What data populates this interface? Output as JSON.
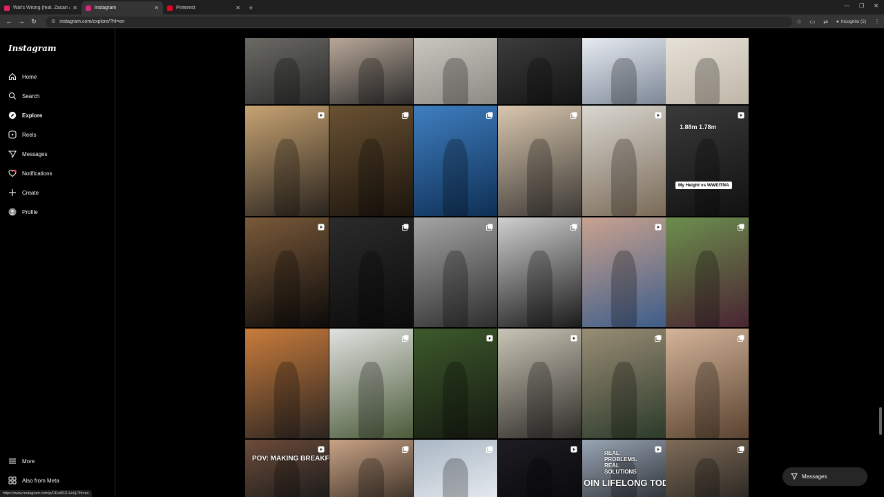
{
  "browser": {
    "tabs": [
      {
        "title": "Wat's Wrong (feat. Zacari & Ke",
        "color": "#e0245e",
        "icon": "youtube-icon"
      },
      {
        "title": "Instagram",
        "color": "#d62976",
        "icon": "instagram-icon"
      },
      {
        "title": "Pinterest",
        "color": "#e60023",
        "icon": "pinterest-icon"
      }
    ],
    "url": "instagram.com/explore/?hl=en",
    "incognito_label": "Incognito (2)",
    "status_url": "https://www.instagram.com/p/DRu8SD-Eu0j/?hl=en"
  },
  "sidebar": {
    "logo": "Instagram",
    "items": [
      {
        "label": "Home",
        "icon": "home-icon"
      },
      {
        "label": "Search",
        "icon": "search-icon"
      },
      {
        "label": "Explore",
        "icon": "compass-icon"
      },
      {
        "label": "Reels",
        "icon": "reels-icon"
      },
      {
        "label": "Messages",
        "icon": "send-icon"
      },
      {
        "label": "Notifications",
        "icon": "heart-icon"
      },
      {
        "label": "Create",
        "icon": "plus-icon"
      },
      {
        "label": "Profile",
        "icon": "avatar-icon"
      }
    ],
    "bottom_items": [
      {
        "label": "More",
        "icon": "menu-icon"
      },
      {
        "label": "Also from Meta",
        "icon": "meta-icon"
      }
    ]
  },
  "grid": {
    "tiles": [
      {
        "bg": "#6b6a65",
        "bg2": "#2a2a2a",
        "badge": "",
        "caption": ""
      },
      {
        "bg": "#b9a899",
        "bg2": "#2b2b2b",
        "badge": "",
        "caption": ""
      },
      {
        "bg": "#c9c6c0",
        "bg2": "#8d8a84",
        "badge": "",
        "caption": ""
      },
      {
        "bg": "#3c3c3c",
        "bg2": "#141414",
        "badge": "",
        "caption": ""
      },
      {
        "bg": "#e8ecf2",
        "bg2": "#7c8796",
        "badge": "",
        "caption": ""
      },
      {
        "bg": "#e6e1d8",
        "bg2": "#bfb6a7",
        "badge": "",
        "caption": ""
      },
      {
        "bg": "#c7a372",
        "bg2": "#2a241e",
        "badge": "reel",
        "caption": ""
      },
      {
        "bg": "#6a5233",
        "bg2": "#1b140d",
        "badge": "carousel",
        "caption": ""
      },
      {
        "bg": "#3f7fc0",
        "bg2": "#0e2f55",
        "badge": "carousel",
        "caption": ""
      },
      {
        "bg": "#d9c6ae",
        "bg2": "#3d3a36",
        "badge": "carousel",
        "caption": ""
      },
      {
        "bg": "#d9d7d1",
        "bg2": "#7a6a57",
        "badge": "reel",
        "caption": ""
      },
      {
        "bg": "#3a3a3a",
        "bg2": "#111",
        "badge": "reel",
        "caption": "1.88m  1.78m",
        "pill": "My Height vs WWE/TNA"
      },
      {
        "bg": "#7a5a3a",
        "bg2": "#0c0a09",
        "badge": "reel",
        "caption": ""
      },
      {
        "bg": "#2b2b2b",
        "bg2": "#0b0b0b",
        "badge": "carousel",
        "caption": ""
      },
      {
        "bg": "#a5a5a5",
        "bg2": "#2e2e2e",
        "badge": "carousel",
        "caption": ""
      },
      {
        "bg": "#cfcfcf",
        "bg2": "#1b1b1b",
        "badge": "carousel",
        "caption": ""
      },
      {
        "bg": "#c9a28e",
        "bg2": "#3d5d8a",
        "badge": "reel",
        "caption": ""
      },
      {
        "bg": "#6b8f4e",
        "bg2": "#4a2431",
        "badge": "carousel",
        "caption": ""
      },
      {
        "bg": "#c97c3b",
        "bg2": "#2b2522",
        "badge": "",
        "caption": ""
      },
      {
        "bg": "#e0e2e0",
        "bg2": "#4c5b3a",
        "badge": "carousel",
        "caption": ""
      },
      {
        "bg": "#3d5a2c",
        "bg2": "#151a10",
        "badge": "reel",
        "caption": ""
      },
      {
        "bg": "#c9c4b5",
        "bg2": "#2f2d2a",
        "badge": "reel",
        "caption": ""
      },
      {
        "bg": "#9a8d76",
        "bg2": "#2b3a2a",
        "badge": "carousel",
        "caption": ""
      },
      {
        "bg": "#d4b49a",
        "bg2": "#5a4330",
        "badge": "carousel",
        "caption": ""
      },
      {
        "bg": "#6d4c3a",
        "bg2": "#1a1a1a",
        "badge": "reel",
        "caption": "POV: MAKING BREAKFAST"
      },
      {
        "bg": "#c9a486",
        "bg2": "#3b2f27",
        "badge": "carousel",
        "caption": ""
      },
      {
        "bg": "#a9b6c4",
        "bg2": "#e7ecf0",
        "badge": "carousel",
        "caption": ""
      },
      {
        "bg": "#1c1c22",
        "bg2": "#0a0a0c",
        "badge": "reel",
        "caption": ""
      },
      {
        "bg": "#9aa6b4",
        "bg2": "#2b2f36",
        "badge": "reel",
        "caption": "REAL PROBLEMS. REAL SOLUTIONS",
        "caption2": "OIN LIFELONG TODAY"
      },
      {
        "bg": "#7f6c58",
        "bg2": "#2a2622",
        "badge": "carousel",
        "caption": ""
      }
    ]
  },
  "messages_button": {
    "label": "Messages"
  }
}
